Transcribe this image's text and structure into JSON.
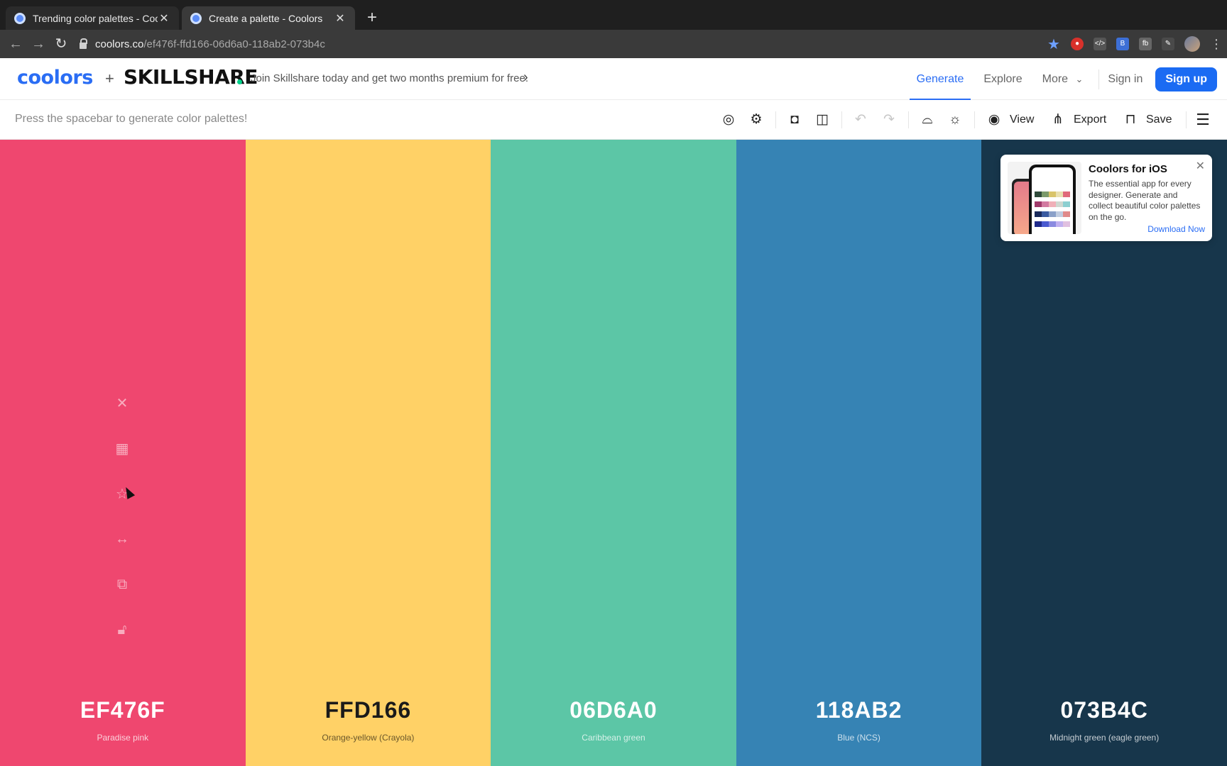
{
  "browser": {
    "tabs": [
      {
        "title": "Trending color palettes - Coolo",
        "active": false
      },
      {
        "title": "Create a palette - Coolors",
        "active": true
      }
    ],
    "url_host": "coolors.co",
    "url_path": "/ef476f-ffd166-06d6a0-118ab2-073b4c"
  },
  "header": {
    "logo": "coolors",
    "plus": "+",
    "partner_logo": "SKILLSHARE",
    "promo": "Join Skillshare today and get two months premium for free.",
    "nav": {
      "generate": "Generate",
      "explore": "Explore",
      "more": "More",
      "sign_in": "Sign in",
      "sign_up": "Sign up"
    }
  },
  "toolbar": {
    "hint": "Press the spacebar to generate color palettes!",
    "view": "View",
    "export": "Export",
    "save": "Save"
  },
  "palette": [
    {
      "hex": "EF476F",
      "name": "Paradise pink",
      "color": "#EF476F",
      "text": "light"
    },
    {
      "hex": "FFD166",
      "name": "Orange-yellow (Crayola)",
      "color": "#FFD166",
      "text": "dark"
    },
    {
      "hex": "06D6A0",
      "name": "Caribbean green",
      "color": "#5CC6A6",
      "text": "light"
    },
    {
      "hex": "118AB2",
      "name": "Blue (NCS)",
      "color": "#3683B4",
      "text": "light"
    },
    {
      "hex": "073B4C",
      "name": "Midnight green (eagle green)",
      "color": "#17364B",
      "text": "light"
    }
  ],
  "ios_promo": {
    "title": "Coolors for iOS",
    "body": "The essential app for every designer. Generate and collect beautiful color palettes on the go.",
    "cta": "Download Now"
  },
  "colors": {
    "accent": "#2a6df4",
    "signup_bg": "#1b6bf3"
  }
}
